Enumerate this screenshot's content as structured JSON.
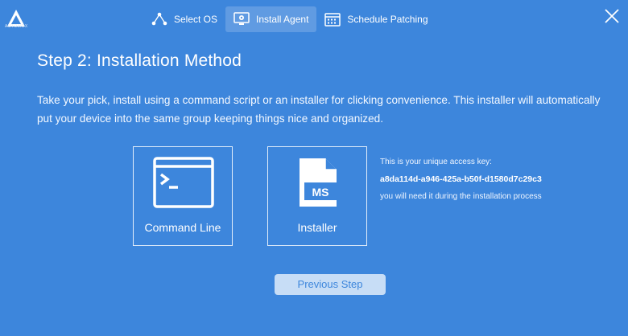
{
  "logo": {
    "text": "AUTOMOX"
  },
  "steps": [
    {
      "label": "Select OS",
      "icon": "network-nodes-icon"
    },
    {
      "label": "Install Agent",
      "icon": "monitor-gear-icon",
      "active": true
    },
    {
      "label": "Schedule Patching",
      "icon": "calendar-icon"
    }
  ],
  "page": {
    "title": "Step 2: Installation Method",
    "description": "Take your pick, install using a command script or an installer for clicking convenience. This installer will automatically put your device into the same group keeping things nice and organized."
  },
  "options": {
    "command_line": "Command Line",
    "installer": "Installer",
    "installer_badge": "MS"
  },
  "access_key": {
    "intro": "This is your unique access key:",
    "key": "a8da114d-a946-425a-b50f-d1580d7c29c3",
    "note": "you will need it during the installation process"
  },
  "footer": {
    "previous_label": "Previous Step"
  },
  "colors": {
    "background": "#3d86dc",
    "button_bg": "#c7ddf6"
  }
}
